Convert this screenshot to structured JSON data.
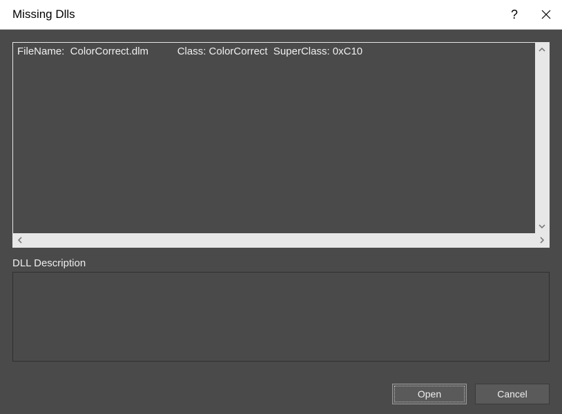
{
  "titlebar": {
    "title": "Missing Dlls",
    "help_tooltip": "Help",
    "close_tooltip": "Close"
  },
  "list": {
    "rows": [
      "FileName:  ColorCorrect.dlm          Class: ColorCorrect  SuperClass: 0xC10"
    ]
  },
  "description": {
    "label": "DLL Description",
    "text": ""
  },
  "buttons": {
    "open": "Open",
    "cancel": "Cancel"
  }
}
